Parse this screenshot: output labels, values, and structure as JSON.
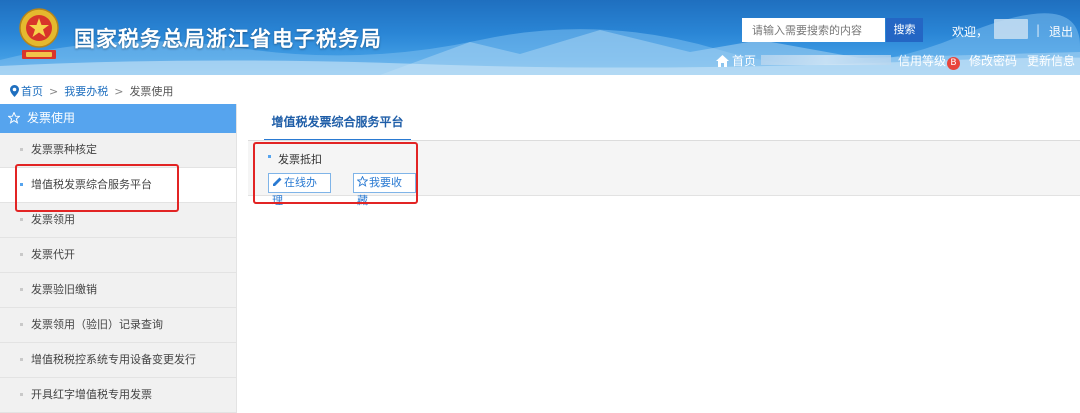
{
  "header": {
    "site_title": "国家税务总局浙江省电子税务局",
    "search_placeholder": "请输入需要搜索的内容",
    "search_button": "搜索",
    "welcome": "欢迎，",
    "separator": "|",
    "logout": "退出",
    "home": "首页",
    "credit_label": "信用等级",
    "credit_grade": "B",
    "change_password": "修改密码",
    "update_info": "更新信息",
    "colors": {
      "banner_top": "#1f6fbf",
      "banner_bottom": "#6bb6ec"
    }
  },
  "breadcrumb": {
    "items": [
      "首页",
      "我要办税",
      "发票使用"
    ],
    "separator": ">",
    "icon": "location-pin-icon"
  },
  "sidebar": {
    "title": "发票使用",
    "title_icon": "star-outline-icon",
    "items": [
      {
        "label": "发票票种核定"
      },
      {
        "label": "增值税发票综合服务平台",
        "active": true
      },
      {
        "label": "发票领用"
      },
      {
        "label": "发票代开"
      },
      {
        "label": "发票验旧缴销"
      },
      {
        "label": "发票领用（验旧）记录查询"
      },
      {
        "label": "增值税税控系统专用设备变更发行"
      },
      {
        "label": "开具红字增值税专用发票"
      }
    ]
  },
  "main": {
    "tab_label": "增值税发票综合服务平台",
    "section_title": "发票抵扣",
    "online_button": "在线办理",
    "favorite_button": "我要收藏",
    "colors": {
      "accent": "#2a7ad2",
      "annotation_red": "#e22424"
    }
  }
}
